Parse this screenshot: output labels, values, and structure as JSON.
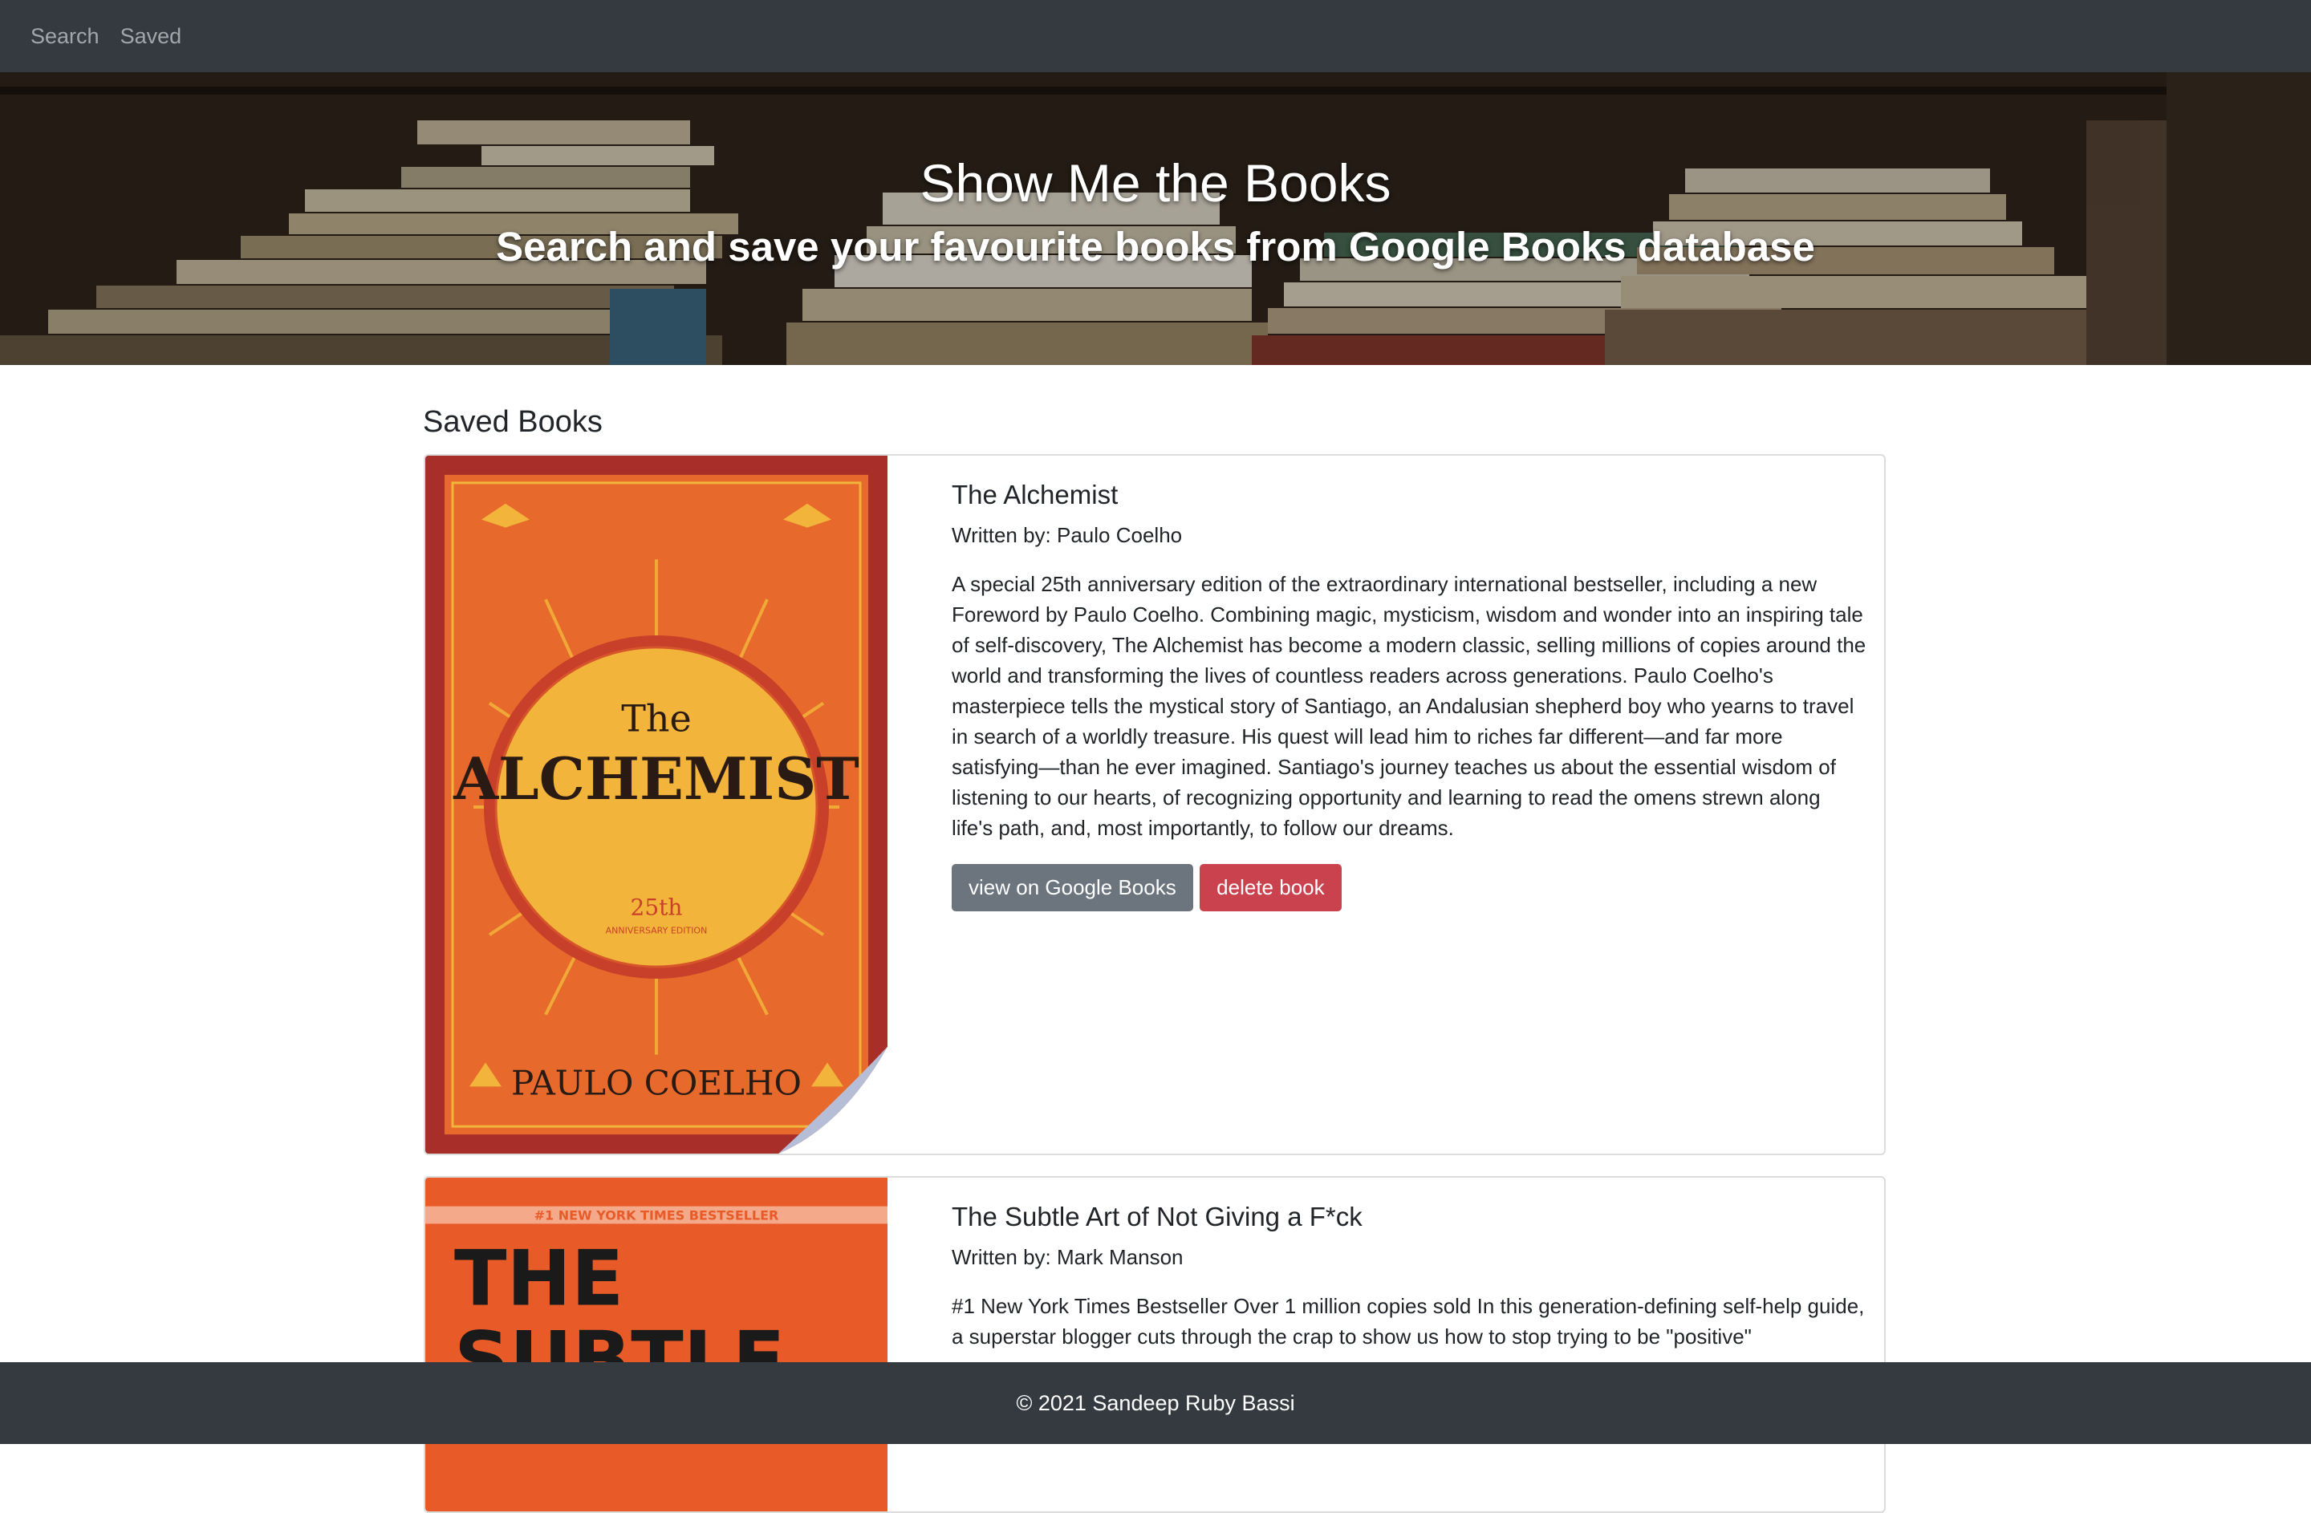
{
  "nav": {
    "items": [
      {
        "label": "Search"
      },
      {
        "label": "Saved"
      }
    ]
  },
  "hero": {
    "title": "Show Me the Books",
    "subtitle": "Search and save your favourite books from Google Books database"
  },
  "saved": {
    "heading": "Saved Books",
    "books": [
      {
        "title": "The Alchemist",
        "author_line": "Written by: Paulo Coelho",
        "description": "A special 25th anniversary edition of the extraordinary international bestseller, including a new Foreword by Paulo Coelho. Combining magic, mysticism, wisdom and wonder into an inspiring tale of self-discovery, The Alchemist has become a modern classic, selling millions of copies around the world and transforming the lives of countless readers across generations. Paulo Coelho's masterpiece tells the mystical story of Santiago, an Andalusian shepherd boy who yearns to travel in search of a worldly treasure. His quest will lead him to riches far different—and far more satisfying—than he ever imagined. Santiago's journey teaches us about the essential wisdom of listening to our hearts, of recognizing opportunity and learning to read the omens strewn along life's path, and, most importantly, to follow our dreams.",
        "view_button": "view on Google Books",
        "delete_button": "delete book",
        "cover": {
          "title_small": "The",
          "title_large": "ALCHEMIST",
          "edition": "25th",
          "edition_sub": "ANNIVERSARY EDITION",
          "author": "PAULO COELHO"
        }
      },
      {
        "title": "The Subtle Art of Not Giving a F*ck",
        "author_line": "Written by: Mark Manson",
        "description": "#1 New York Times Bestseller Over 1 million copies sold In this generation-defining self-help guide, a superstar blogger cuts through the crap to show us how to stop trying to be \"positive\"",
        "cover": {
          "banner": "#1 NEW YORK TIMES BESTSELLER",
          "line1": "THE",
          "line2": "SUBTLE"
        }
      }
    ]
  },
  "footer": {
    "text": "© 2021 Sandeep Ruby Bassi"
  },
  "colors": {
    "navbar_bg": "#343a40",
    "view_button_bg": "#6c757d",
    "delete_button_bg": "#c9424d",
    "alchemist_cover_red": "#a82e2a",
    "alchemist_cover_orange": "#e76a2c",
    "alchemist_cover_gold": "#f2b43a",
    "subtle_cover_orange": "#e85a27"
  }
}
